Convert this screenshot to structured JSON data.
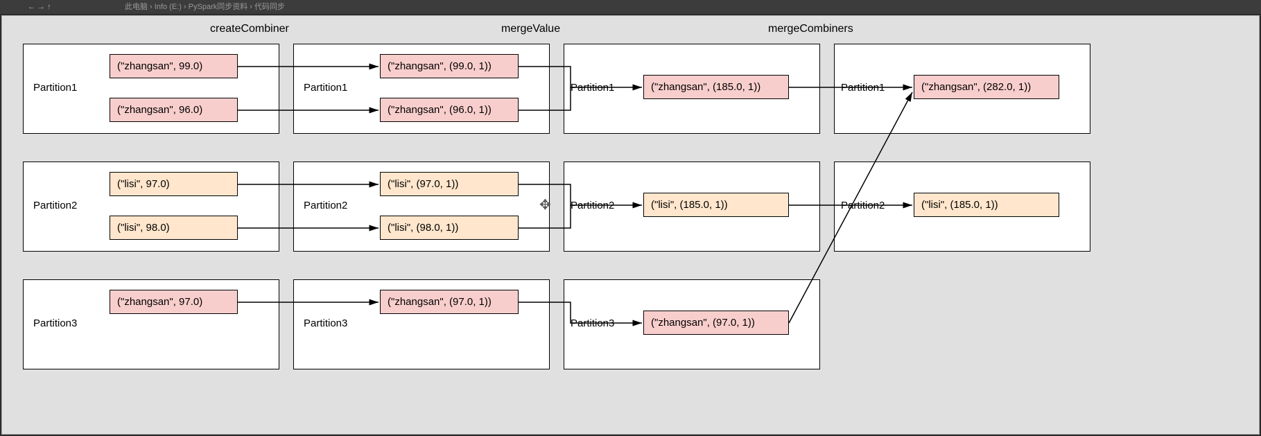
{
  "topbar": {
    "breadcrumb": "此电脑 › Info (E:) › PySpark同步资料 › 代码同步"
  },
  "headers": {
    "createCombiner": "createCombiner",
    "mergeValue": "mergeValue",
    "mergeCombiners": "mergeCombiners"
  },
  "labels": {
    "partition1": "Partition1",
    "partition2": "Partition2",
    "partition3": "Partition3"
  },
  "col1": {
    "p1": {
      "a": "(\"zhangsan\", 99.0)",
      "b": "(\"zhangsan\", 96.0)"
    },
    "p2": {
      "a": "(\"lisi\", 97.0)",
      "b": "(\"lisi\", 98.0)"
    },
    "p3": {
      "a": "(\"zhangsan\", 97.0)"
    }
  },
  "col2": {
    "p1": {
      "a": "(\"zhangsan\", (99.0, 1))",
      "b": "(\"zhangsan\", (96.0, 1))"
    },
    "p2": {
      "a": "(\"lisi\", (97.0, 1))",
      "b": "(\"lisi\", (98.0, 1))"
    },
    "p3": {
      "a": "(\"zhangsan\", (97.0, 1))"
    }
  },
  "col3": {
    "p1": {
      "a": "(\"zhangsan\", (185.0, 1))"
    },
    "p2": {
      "a": "(\"lisi\", (185.0, 1))"
    },
    "p3": {
      "a": "(\"zhangsan\", (97.0, 1))"
    }
  },
  "col4": {
    "p1": {
      "a": "(\"zhangsan\", (282.0, 1))"
    },
    "p2": {
      "a": "(\"lisi\", (185.0, 1))"
    }
  }
}
